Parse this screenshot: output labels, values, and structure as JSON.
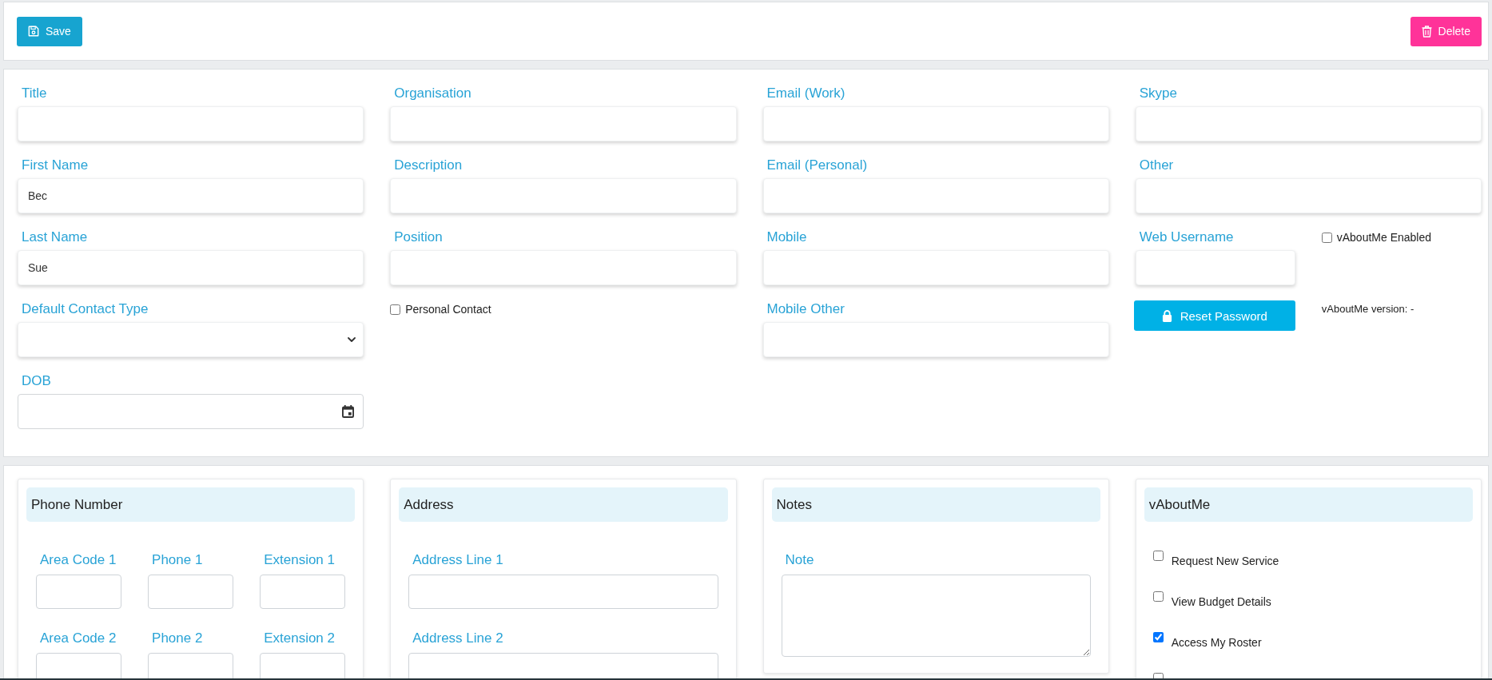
{
  "toolbar": {
    "buttons": [
      {
        "label": "Save",
        "kind": "save"
      },
      {
        "label": "Delete",
        "kind": "delete"
      }
    ]
  },
  "details": {
    "columns": [
      {
        "fields": [
          {
            "label": "Title",
            "kind": "text"
          },
          {
            "label": "First Name",
            "kind": "text",
            "value": "Bec"
          },
          {
            "label": "Last Name",
            "kind": "text",
            "value": "Sue"
          },
          {
            "label": "Default Contact Type",
            "kind": "select"
          },
          {
            "label": "DOB",
            "kind": "date"
          }
        ]
      },
      {
        "fields": [
          {
            "label": "Organisation",
            "kind": "text"
          },
          {
            "label": "Description",
            "kind": "text"
          },
          {
            "label": "Position",
            "kind": "text"
          },
          {
            "label": "Personal Contact",
            "kind": "checkbox",
            "checked": false
          }
        ]
      },
      {
        "fields": [
          {
            "label": "Email (Work)",
            "kind": "text"
          },
          {
            "label": "Email (Personal)",
            "kind": "text"
          },
          {
            "label": "Mobile",
            "kind": "text"
          },
          {
            "label": "Mobile Other",
            "kind": "text"
          }
        ]
      },
      {
        "fields": [
          {
            "label": "Skype",
            "kind": "text"
          },
          {
            "label": "Other",
            "kind": "text"
          }
        ],
        "web_access": {
          "username": {
            "label": "Web Username",
            "kind": "text"
          },
          "vaboutme_enabled": {
            "label": "vAboutMe Enabled",
            "kind": "checkbox",
            "checked": false
          },
          "reset_button": "Reset Password",
          "version": "vAboutMe version: -"
        }
      }
    ]
  },
  "panels": [
    {
      "title": "Phone Number",
      "kind": "phone",
      "fields": [
        {
          "label": "Area Code 1"
        },
        {
          "label": "Phone 1"
        },
        {
          "label": "Extension 1"
        },
        {
          "label": "Area Code 2"
        },
        {
          "label": "Phone 2"
        },
        {
          "label": "Extension 2"
        }
      ]
    },
    {
      "title": "Address",
      "kind": "address",
      "fields": [
        {
          "label": "Address Line 1"
        },
        {
          "label": "Address Line 2"
        }
      ]
    },
    {
      "title": "Notes",
      "kind": "notes",
      "fields": [
        {
          "label": "Note"
        }
      ]
    },
    {
      "title": "vAboutMe",
      "kind": "options",
      "options": [
        {
          "label": "Request New Service",
          "checked": false
        },
        {
          "label": "View Budget Details",
          "checked": false
        },
        {
          "label": "Access My Roster",
          "checked": true
        },
        {
          "checked": false
        }
      ]
    }
  ]
}
